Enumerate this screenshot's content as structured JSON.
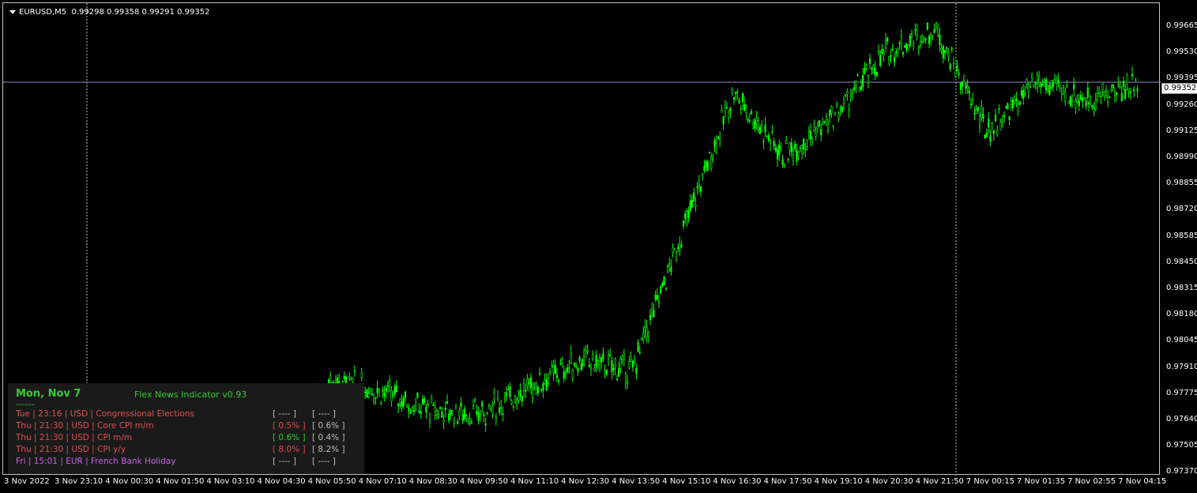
{
  "header": {
    "symbol": "EURUSD,M5",
    "ohlc": "0.99298 0.99358 0.99291 0.99352"
  },
  "current_price": "0.99352",
  "colors": {
    "candle": "#00ff00",
    "background": "#000000",
    "price_line": "#8c8cc8",
    "event_red": "#e05050",
    "event_green": "#32cd32",
    "event_violet": "#c864e6",
    "neutral": "#bebebe"
  },
  "y_axis": [
    "0.99665",
    "0.99530",
    "0.99395",
    "0.99260",
    "0.99125",
    "0.98990",
    "0.98855",
    "0.98720",
    "0.98585",
    "0.98450",
    "0.98315",
    "0.98180",
    "0.98045",
    "0.97910",
    "0.97775",
    "0.97640",
    "0.97505",
    "0.97370"
  ],
  "x_axis": [
    "3 Nov 2022",
    "3 Nov 23:10",
    "4 Nov 00:30",
    "4 Nov 01:50",
    "4 Nov 03:10",
    "4 Nov 04:30",
    "4 Nov 05:50",
    "4 Nov 07:10",
    "4 Nov 08:30",
    "4 Nov 09:50",
    "4 Nov 11:10",
    "4 Nov 12:30",
    "4 Nov 13:50",
    "4 Nov 15:10",
    "4 Nov 16:30",
    "4 Nov 17:50",
    "4 Nov 19:10",
    "4 Nov 20:30",
    "4 Nov 21:50",
    "7 Nov 00:15",
    "7 Nov 01:35",
    "7 Nov 02:55",
    "7 Nov 04:15"
  ],
  "chart_data": {
    "type": "candlestick",
    "symbol": "EURUSD",
    "timeframe": "M5",
    "ylim": [
      0.9737,
      0.9975
    ],
    "path": [
      [
        "4 Nov 05:50",
        0.9785
      ],
      [
        "4 Nov 07:10",
        0.978
      ],
      [
        "4 Nov 08:30",
        0.977
      ],
      [
        "4 Nov 09:50",
        0.9768
      ],
      [
        "4 Nov 11:10",
        0.9782
      ],
      [
        "4 Nov 12:30",
        0.9795
      ],
      [
        "4 Nov 13:50",
        0.979
      ],
      [
        "4 Nov 15:10",
        0.986
      ],
      [
        "4 Nov 16:30",
        0.993
      ],
      [
        "4 Nov 17:50",
        0.9898
      ],
      [
        "4 Nov 19:10",
        0.9918
      ],
      [
        "4 Nov 20:30",
        0.995
      ],
      [
        "4 Nov 21:50",
        0.9962
      ],
      [
        "7 Nov 00:15",
        0.991
      ],
      [
        "7 Nov 01:35",
        0.9935
      ],
      [
        "7 Nov 02:55",
        0.9926
      ],
      [
        "7 Nov 04:15",
        0.9935
      ]
    ]
  },
  "news_panel": {
    "date": "Mon, Nov 7",
    "title": "Flex News Indicator v0.93",
    "separator": "------",
    "events": [
      {
        "text": "Tue  |  23:16  |  USD  |  Congressional Elections",
        "forecast": "[ ---- ]",
        "previous": "[ ---- ]",
        "color": "#e05050",
        "fcolor": "#bebebe"
      },
      {
        "text": "Thu  |  21:30  |  USD  |  Core CPI m/m",
        "forecast": "[ 0.5% ]",
        "previous": "[ 0.6% ]",
        "color": "#e05050",
        "fcolor": "#e05050"
      },
      {
        "text": "Thu  |  21:30  |  USD  |  CPI m/m",
        "forecast": "[ 0.6% ]",
        "previous": "[ 0.4% ]",
        "color": "#e05050",
        "fcolor": "#32cd32"
      },
      {
        "text": "Thu  |  21:30  |  USD  |  CPI y/y",
        "forecast": "[ 8.0% ]",
        "previous": "[ 8.2% ]",
        "color": "#e05050",
        "fcolor": "#e05050"
      },
      {
        "text": "Fri  |  15:01  |  EUR  |  French Bank Holiday",
        "forecast": "[ ---- ]",
        "previous": "[ ---- ]",
        "color": "#c864e6",
        "fcolor": "#bebebe"
      }
    ]
  }
}
